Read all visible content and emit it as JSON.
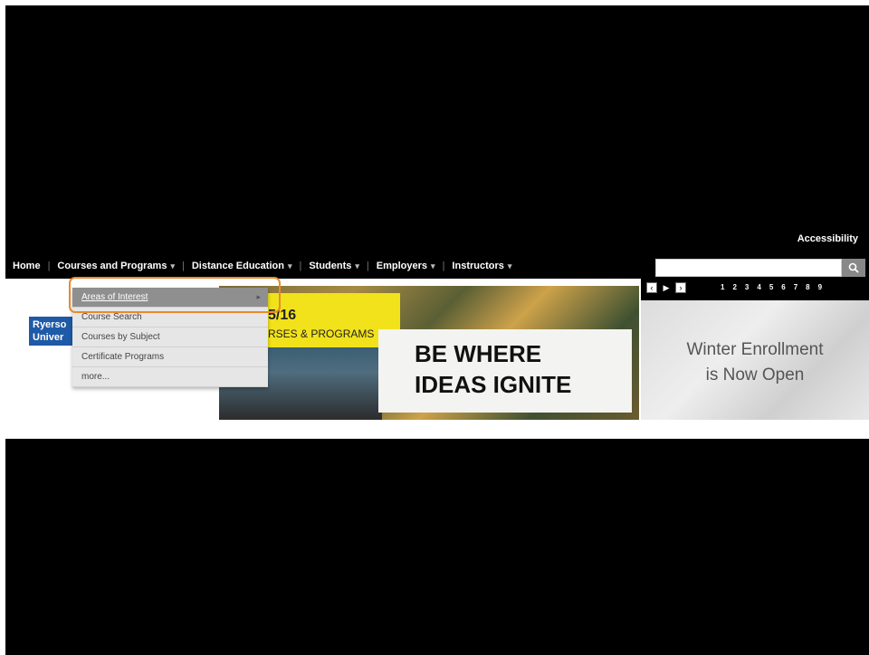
{
  "accessibility_label": "Accessibility",
  "nav": {
    "items": [
      {
        "label": "Home",
        "has_menu": false
      },
      {
        "label": "Courses and Programs",
        "has_menu": true
      },
      {
        "label": "Distance Education",
        "has_menu": true
      },
      {
        "label": "Students",
        "has_menu": true
      },
      {
        "label": "Employers",
        "has_menu": true
      },
      {
        "label": "Instructors",
        "has_menu": true
      }
    ],
    "dropdown": [
      {
        "label": "Areas of Interest",
        "active": true
      },
      {
        "label": "Course Search",
        "active": false
      },
      {
        "label": "Courses by Subject",
        "active": false
      },
      {
        "label": "Certificate Programs",
        "active": false
      },
      {
        "label": "more...",
        "active": false
      }
    ]
  },
  "search": {
    "placeholder": "",
    "button_icon": "search-icon"
  },
  "logo": {
    "line1": "Ryerso",
    "line2": "Univer"
  },
  "hero": {
    "yellow_year": "5/16",
    "yellow_sub": "RSES & PROGRAMS",
    "slogan_line1": "BE WHERE",
    "slogan_line2": "IDEAS IGNITE"
  },
  "promo": {
    "line1": "Winter Enrollment",
    "line2": "is Now Open"
  },
  "slider": {
    "pages": [
      "1",
      "2",
      "3",
      "4",
      "5",
      "6",
      "7",
      "8",
      "9"
    ],
    "prev_icon": "chevron-left-icon",
    "play_icon": "play-icon",
    "next_icon": "chevron-right-icon"
  },
  "colors": {
    "highlight": "#e98a2e",
    "logo_blue": "#1f5aa6",
    "hero_yellow": "#f2e21b"
  }
}
